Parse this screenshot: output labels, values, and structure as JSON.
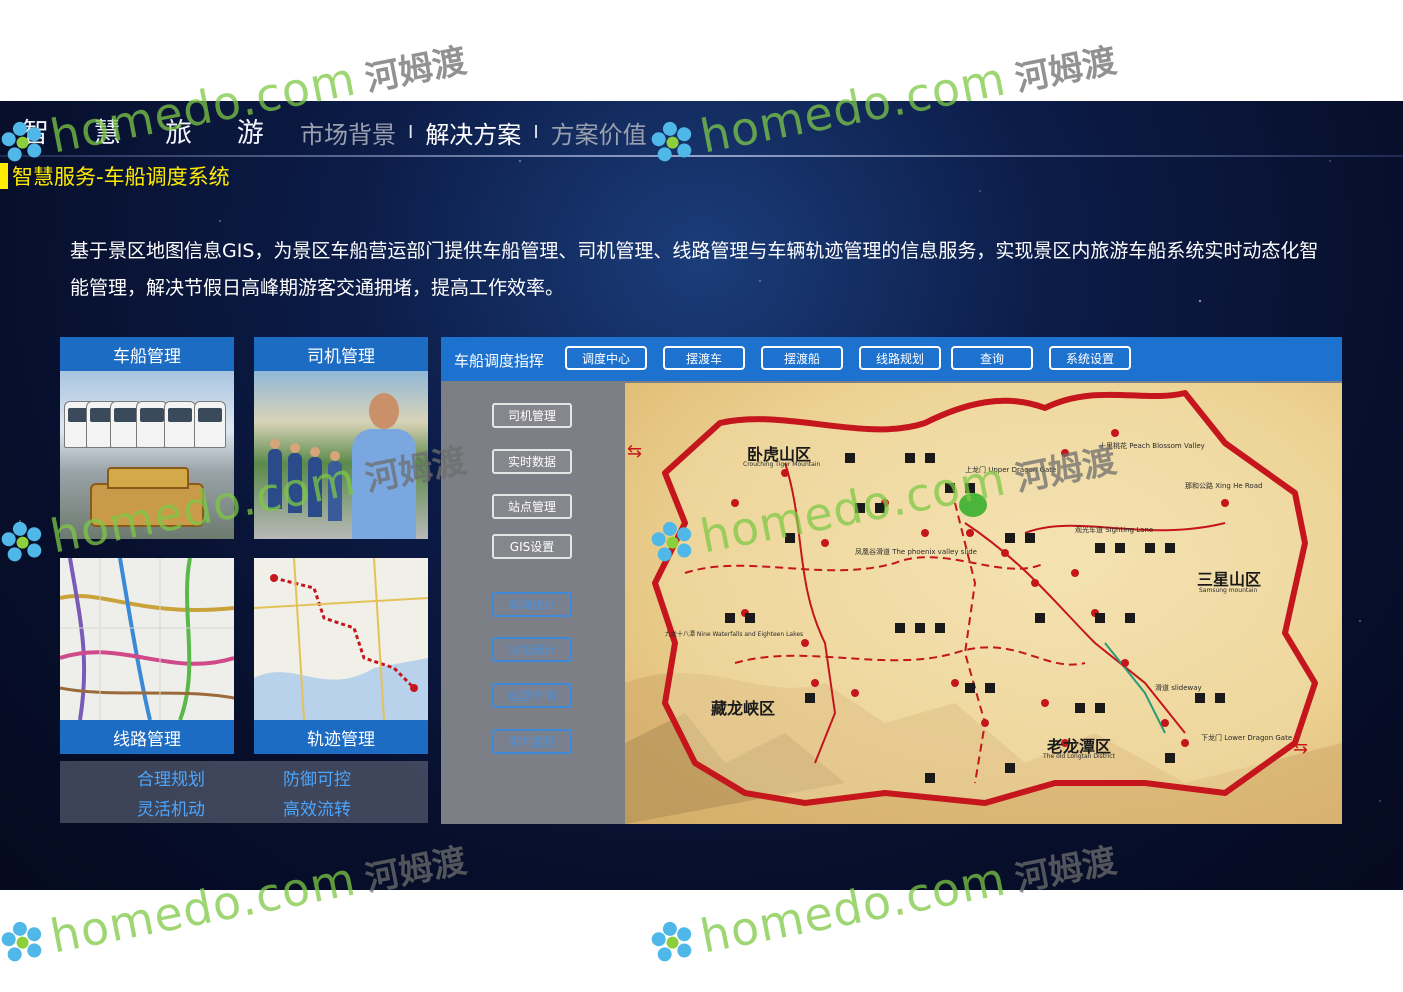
{
  "header": {
    "brand": "智 慧 旅 游",
    "nav": [
      {
        "label": "市场背景"
      },
      {
        "label": "解决方案"
      },
      {
        "label": "方案价值"
      }
    ],
    "separator": "I"
  },
  "section": {
    "title": "智慧服务-车船调度系统"
  },
  "description": "基于景区地图信息GIS，为景区车船营运部门提供车船管理、司机管理、线路管理与车辆轨迹管理的信息服务，实现景区内旅游车船系统实时动态化智能管理，解决节假日高峰期游客交通拥堵，提高工作效率。",
  "cards": {
    "vehicle": "车船管理",
    "driver": "司机管理",
    "route": "线路管理",
    "track": "轨迹管理"
  },
  "features": [
    "合理规划",
    "防御可控",
    "灵活机动",
    "高效流转"
  ],
  "panel": {
    "title": "车船调度指挥",
    "toolbar": [
      "调度中心",
      "摆渡车",
      "摆渡船",
      "线路规划",
      "查询",
      "系统设置"
    ],
    "sidebar": [
      "司机管理",
      "实时数据",
      "站点管理",
      "GIS设置"
    ],
    "sidebar_faded": [
      "车辆统计",
      "状态统计",
      "运营时间",
      "实时监控"
    ],
    "map": {
      "regions": [
        {
          "name": "卧虎山区",
          "en": "Crouching Tiger Mountain"
        },
        {
          "name": "三星山区",
          "en": "Samsung mountain"
        },
        {
          "name": "藏龙峡区",
          "en": ""
        },
        {
          "name": "老龙潭区",
          "en": "The old Longtan District"
        }
      ],
      "places": [
        {
          "name": "上龙门 Upper Dragon Gate"
        },
        {
          "name": "观光车道 Sighting Lane"
        },
        {
          "name": "凤凰谷滑道 The phoenix valley slide"
        },
        {
          "name": "那和公路 Xing He Road"
        },
        {
          "name": "滑道 slideway"
        },
        {
          "name": "下龙门 Lower Dragon Gate"
        },
        {
          "name": "九龙十八潭 Nine Waterfalls and Eighteen Lakes"
        },
        {
          "name": "十里桃花 Peach Blossom Valley"
        }
      ]
    }
  },
  "watermark": {
    "text": "homedo.com",
    "cn": "河姆渡"
  }
}
